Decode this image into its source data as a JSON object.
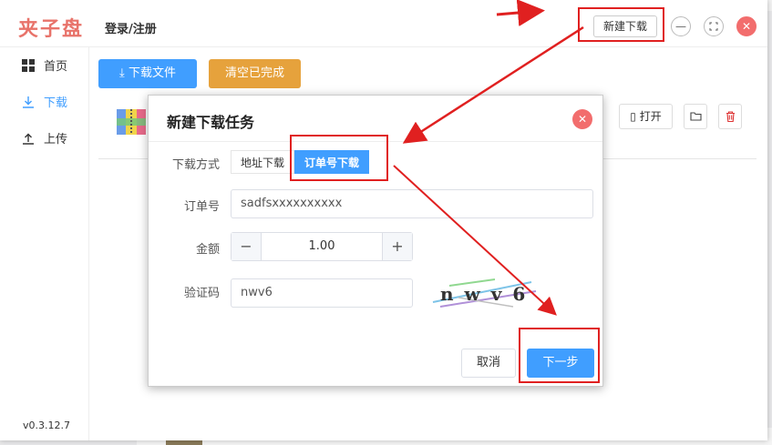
{
  "app": {
    "logo": "夹子盘",
    "login_link": "登录/注册",
    "new_download_button": "新建下载",
    "version": "v0.3.12.7"
  },
  "sidebar": {
    "items": [
      {
        "label": "首页",
        "icon": "grid-icon"
      },
      {
        "label": "下载",
        "icon": "download-icon",
        "active": true
      },
      {
        "label": "上传",
        "icon": "upload-icon"
      }
    ]
  },
  "toolbar": {
    "download_files": "下载文件",
    "clear_completed": "清空已完成"
  },
  "file_row": {
    "open_label": "打开"
  },
  "dialog": {
    "title": "新建下载任务",
    "method_label": "下载方式",
    "method_options": [
      "地址下载",
      "订单号下载"
    ],
    "method_selected": "订单号下载",
    "order_label": "订单号",
    "order_value": "sadfsxxxxxxxxxx",
    "amount_label": "金额",
    "amount_value": "1.00",
    "captcha_label": "验证码",
    "captcha_value": "nwv6",
    "captcha_image_text": "nwv6",
    "cancel_button": "取消",
    "next_button": "下一步"
  },
  "colors": {
    "primary": "#409eff",
    "warning": "#e6a23c",
    "danger": "#f26d6d",
    "logo": "#e8736a",
    "annotation": "#e02020"
  }
}
